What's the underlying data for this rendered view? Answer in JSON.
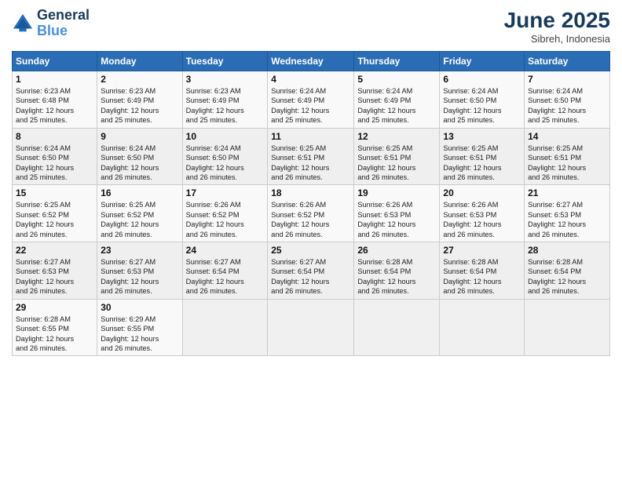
{
  "logo": {
    "line1": "General",
    "line2": "Blue"
  },
  "title": "June 2025",
  "subtitle": "Sibreh, Indonesia",
  "days_header": [
    "Sunday",
    "Monday",
    "Tuesday",
    "Wednesday",
    "Thursday",
    "Friday",
    "Saturday"
  ],
  "weeks": [
    [
      {
        "day": "1",
        "info": "Sunrise: 6:23 AM\nSunset: 6:48 PM\nDaylight: 12 hours\nand 25 minutes."
      },
      {
        "day": "2",
        "info": "Sunrise: 6:23 AM\nSunset: 6:49 PM\nDaylight: 12 hours\nand 25 minutes."
      },
      {
        "day": "3",
        "info": "Sunrise: 6:23 AM\nSunset: 6:49 PM\nDaylight: 12 hours\nand 25 minutes."
      },
      {
        "day": "4",
        "info": "Sunrise: 6:24 AM\nSunset: 6:49 PM\nDaylight: 12 hours\nand 25 minutes."
      },
      {
        "day": "5",
        "info": "Sunrise: 6:24 AM\nSunset: 6:49 PM\nDaylight: 12 hours\nand 25 minutes."
      },
      {
        "day": "6",
        "info": "Sunrise: 6:24 AM\nSunset: 6:50 PM\nDaylight: 12 hours\nand 25 minutes."
      },
      {
        "day": "7",
        "info": "Sunrise: 6:24 AM\nSunset: 6:50 PM\nDaylight: 12 hours\nand 25 minutes."
      }
    ],
    [
      {
        "day": "8",
        "info": "Sunrise: 6:24 AM\nSunset: 6:50 PM\nDaylight: 12 hours\nand 25 minutes."
      },
      {
        "day": "9",
        "info": "Sunrise: 6:24 AM\nSunset: 6:50 PM\nDaylight: 12 hours\nand 26 minutes."
      },
      {
        "day": "10",
        "info": "Sunrise: 6:24 AM\nSunset: 6:50 PM\nDaylight: 12 hours\nand 26 minutes."
      },
      {
        "day": "11",
        "info": "Sunrise: 6:25 AM\nSunset: 6:51 PM\nDaylight: 12 hours\nand 26 minutes."
      },
      {
        "day": "12",
        "info": "Sunrise: 6:25 AM\nSunset: 6:51 PM\nDaylight: 12 hours\nand 26 minutes."
      },
      {
        "day": "13",
        "info": "Sunrise: 6:25 AM\nSunset: 6:51 PM\nDaylight: 12 hours\nand 26 minutes."
      },
      {
        "day": "14",
        "info": "Sunrise: 6:25 AM\nSunset: 6:51 PM\nDaylight: 12 hours\nand 26 minutes."
      }
    ],
    [
      {
        "day": "15",
        "info": "Sunrise: 6:25 AM\nSunset: 6:52 PM\nDaylight: 12 hours\nand 26 minutes."
      },
      {
        "day": "16",
        "info": "Sunrise: 6:25 AM\nSunset: 6:52 PM\nDaylight: 12 hours\nand 26 minutes."
      },
      {
        "day": "17",
        "info": "Sunrise: 6:26 AM\nSunset: 6:52 PM\nDaylight: 12 hours\nand 26 minutes."
      },
      {
        "day": "18",
        "info": "Sunrise: 6:26 AM\nSunset: 6:52 PM\nDaylight: 12 hours\nand 26 minutes."
      },
      {
        "day": "19",
        "info": "Sunrise: 6:26 AM\nSunset: 6:53 PM\nDaylight: 12 hours\nand 26 minutes."
      },
      {
        "day": "20",
        "info": "Sunrise: 6:26 AM\nSunset: 6:53 PM\nDaylight: 12 hours\nand 26 minutes."
      },
      {
        "day": "21",
        "info": "Sunrise: 6:27 AM\nSunset: 6:53 PM\nDaylight: 12 hours\nand 26 minutes."
      }
    ],
    [
      {
        "day": "22",
        "info": "Sunrise: 6:27 AM\nSunset: 6:53 PM\nDaylight: 12 hours\nand 26 minutes."
      },
      {
        "day": "23",
        "info": "Sunrise: 6:27 AM\nSunset: 6:53 PM\nDaylight: 12 hours\nand 26 minutes."
      },
      {
        "day": "24",
        "info": "Sunrise: 6:27 AM\nSunset: 6:54 PM\nDaylight: 12 hours\nand 26 minutes."
      },
      {
        "day": "25",
        "info": "Sunrise: 6:27 AM\nSunset: 6:54 PM\nDaylight: 12 hours\nand 26 minutes."
      },
      {
        "day": "26",
        "info": "Sunrise: 6:28 AM\nSunset: 6:54 PM\nDaylight: 12 hours\nand 26 minutes."
      },
      {
        "day": "27",
        "info": "Sunrise: 6:28 AM\nSunset: 6:54 PM\nDaylight: 12 hours\nand 26 minutes."
      },
      {
        "day": "28",
        "info": "Sunrise: 6:28 AM\nSunset: 6:54 PM\nDaylight: 12 hours\nand 26 minutes."
      }
    ],
    [
      {
        "day": "29",
        "info": "Sunrise: 6:28 AM\nSunset: 6:55 PM\nDaylight: 12 hours\nand 26 minutes."
      },
      {
        "day": "30",
        "info": "Sunrise: 6:29 AM\nSunset: 6:55 PM\nDaylight: 12 hours\nand 26 minutes."
      },
      {
        "day": "",
        "info": ""
      },
      {
        "day": "",
        "info": ""
      },
      {
        "day": "",
        "info": ""
      },
      {
        "day": "",
        "info": ""
      },
      {
        "day": "",
        "info": ""
      }
    ]
  ]
}
